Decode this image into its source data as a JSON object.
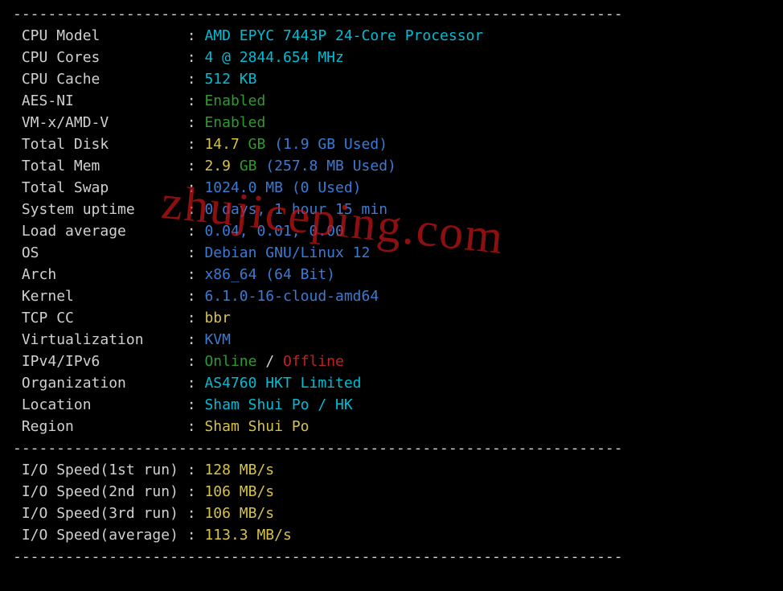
{
  "dashes_top": "----------------------------------------------------------------------",
  "dashes_mid": "----------------------------------------------------------------------",
  "dashes_bot": "----------------------------------------------------------------------",
  "watermark": "zhujiceping.com",
  "rows": {
    "cpu_model": {
      "label": "CPU Model",
      "value": "AMD EPYC 7443P 24-Core Processor"
    },
    "cpu_cores": {
      "label": "CPU Cores",
      "value": "4 @ 2844.654 MHz"
    },
    "cpu_cache": {
      "label": "CPU Cache",
      "value": "512 KB"
    },
    "aes_ni": {
      "label": "AES-NI",
      "value": "Enabled"
    },
    "vmx": {
      "label": "VM-x/AMD-V",
      "value": "Enabled"
    },
    "disk": {
      "label": "Total Disk",
      "num": "14.7",
      "unit": "GB",
      "used": "(1.9 GB Used)"
    },
    "mem": {
      "label": "Total Mem",
      "num": "2.9",
      "unit": "GB",
      "used": "(257.8 MB Used)"
    },
    "swap": {
      "label": "Total Swap",
      "value": "1024.0 MB (0 Used)"
    },
    "uptime": {
      "label": "System uptime",
      "value": "0 days, 1 hour 15 min"
    },
    "load": {
      "label": "Load average",
      "value": "0.04, 0.01, 0.00"
    },
    "os": {
      "label": "OS",
      "value": "Debian GNU/Linux 12"
    },
    "arch": {
      "label": "Arch",
      "value": "x86_64 (64 Bit)"
    },
    "kernel": {
      "label": "Kernel",
      "value": "6.1.0-16-cloud-amd64"
    },
    "tcpcc": {
      "label": "TCP CC",
      "value": "bbr"
    },
    "virt": {
      "label": "Virtualization",
      "value": "KVM"
    },
    "ipv": {
      "label": "IPv4/IPv6",
      "v4": "Online",
      "sep": "/",
      "v6": "Offline"
    },
    "org": {
      "label": "Organization",
      "value": "AS4760 HKT Limited"
    },
    "loc": {
      "label": "Location",
      "value": "Sham Shui Po / HK"
    },
    "region": {
      "label": "Region",
      "value": "Sham Shui Po"
    }
  },
  "io": {
    "r1": {
      "label": "I/O Speed(1st run)",
      "value": "128 MB/s"
    },
    "r2": {
      "label": "I/O Speed(2nd run)",
      "value": "106 MB/s"
    },
    "r3": {
      "label": "I/O Speed(3rd run)",
      "value": "106 MB/s"
    },
    "avg": {
      "label": "I/O Speed(average)",
      "value": "113.3 MB/s"
    }
  }
}
